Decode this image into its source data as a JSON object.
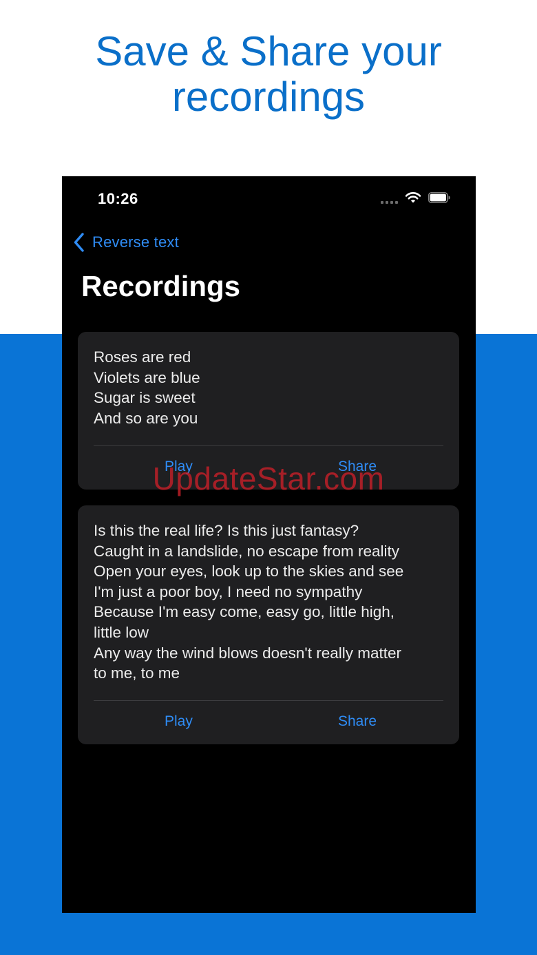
{
  "headline": {
    "line1": "Save & Share your",
    "line2": "recordings"
  },
  "status_bar": {
    "time": "10:26"
  },
  "nav": {
    "back_label": "Reverse text"
  },
  "page": {
    "title": "Recordings"
  },
  "recordings": [
    {
      "text": "Roses are red\nViolets are blue\nSugar is sweet\nAnd so are you",
      "play_label": "Play",
      "share_label": "Share"
    },
    {
      "text": "Is this the real life? Is this just fantasy?\nCaught in a landslide, no escape from reality\nOpen your eyes, look up to the skies and see\nI'm just a poor boy, I need no sympathy\nBecause I'm easy come, easy go, little high,\nlittle low\nAny way the wind blows doesn't really matter\nto me, to me",
      "play_label": "Play",
      "share_label": "Share"
    }
  ],
  "watermark": "UpdateStar.com",
  "colors": {
    "brand_blue": "#0a74d6",
    "link_blue": "#2f8cf5",
    "card_bg": "#1f1f21"
  }
}
